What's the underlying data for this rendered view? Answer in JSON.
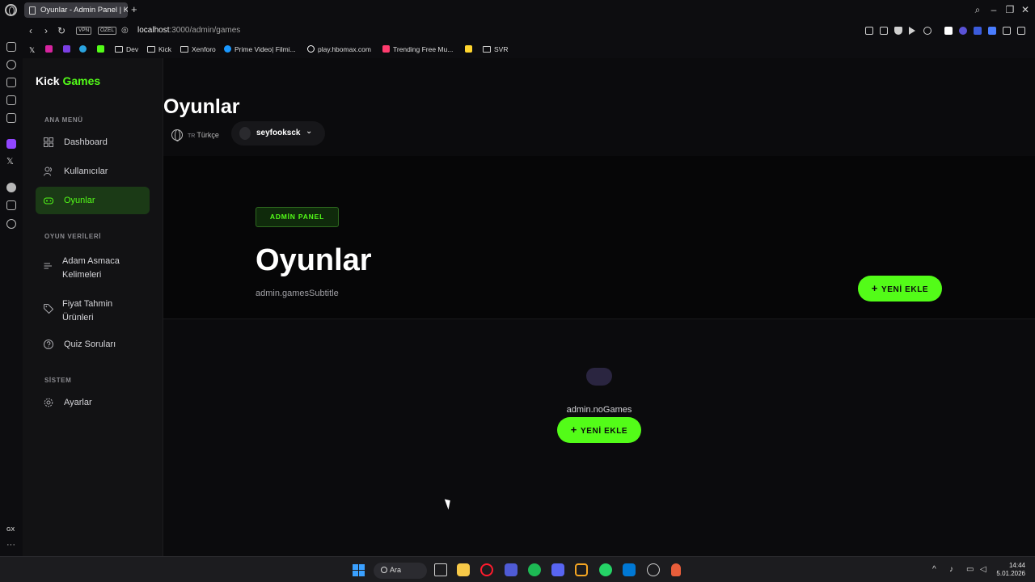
{
  "browser": {
    "tab_title": "Oyunlar - Admin Panel | Ki",
    "new_tab": "+",
    "window_controls": [
      "search-icon",
      "minimize-icon",
      "restore-icon",
      "close-icon"
    ],
    "vpn_label": "VPN",
    "private_label": "ÖZEL",
    "url_host": "localhost",
    "url_path": ":3000/admin/games",
    "bookmarks": [
      {
        "label": "",
        "icon": "x-icon"
      },
      {
        "label": "",
        "icon": "instagram-icon"
      },
      {
        "label": "",
        "icon": "s-icon"
      },
      {
        "label": "",
        "icon": "telegram-icon"
      },
      {
        "label": "",
        "icon": "kick-icon"
      },
      {
        "label": "Dev",
        "icon": "folder-icon"
      },
      {
        "label": "Kick",
        "icon": "folder-icon"
      },
      {
        "label": "Xenforo",
        "icon": "folder-icon"
      },
      {
        "label": "Prime Video| Filmi...",
        "icon": "prime-icon"
      },
      {
        "label": "play.hbomax.com",
        "icon": "hbo-icon"
      },
      {
        "label": "Trending Free Mu...",
        "icon": "music-icon"
      },
      {
        "label": "",
        "icon": "note-icon"
      },
      {
        "label": "SVR",
        "icon": "folder-icon"
      }
    ],
    "side_bottom_label": "GX"
  },
  "sidebar": {
    "brand_primary": "Kick",
    "brand_accent": "Games",
    "sections": [
      {
        "label": "ANA MENÜ"
      },
      {
        "label": "OYUN VERİLERİ"
      },
      {
        "label": "SİSTEM"
      }
    ],
    "items": [
      {
        "label": "Dashboard",
        "icon": "dashboard-icon"
      },
      {
        "label": "Kullanıcılar",
        "icon": "users-icon"
      },
      {
        "label": "Oyunlar",
        "icon": "gamepad-icon"
      },
      {
        "label": "Adam Asmaca Kelimeleri",
        "icon": "list-icon"
      },
      {
        "label": "Fiyat Tahmin Ürünleri",
        "icon": "tag-icon"
      },
      {
        "label": "Quiz Soruları",
        "icon": "question-icon"
      },
      {
        "label": "Ayarlar",
        "icon": "settings-icon"
      }
    ]
  },
  "header": {
    "page_title": "Oyunlar",
    "lang_code": "TR",
    "lang_label": "Türkçe",
    "user_name": "seyfooksck"
  },
  "hero": {
    "badge": "ADMİN PANEL",
    "title": "Oyunlar",
    "subtitle": "admin.gamesSubtitle",
    "add_button": "YENİ EKLE"
  },
  "empty_state": {
    "text": "admin.noGames",
    "add_button": "YENİ EKLE"
  },
  "taskbar": {
    "search_label": "Ara",
    "time": "14:44",
    "date": "5.01.2026"
  },
  "colors": {
    "accent": "#53fc18",
    "background": "#0b0b0d",
    "sidebar": "#121214"
  }
}
